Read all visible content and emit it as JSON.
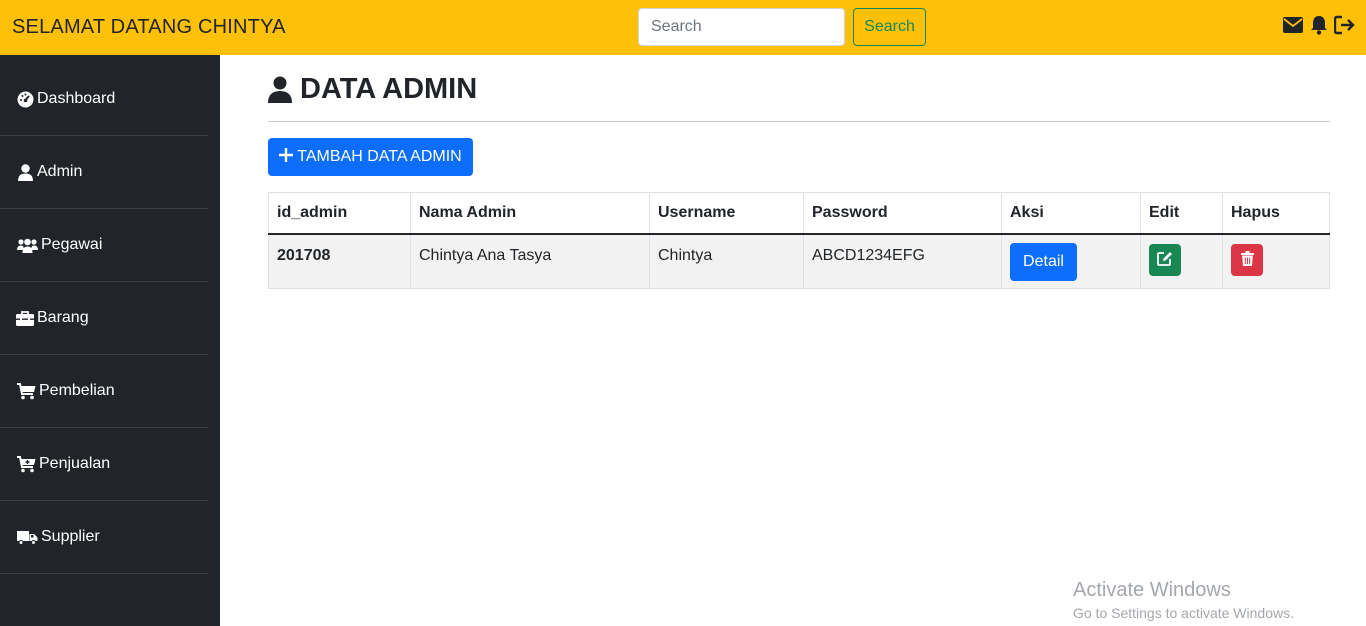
{
  "header": {
    "brand": "SELAMAT DATANG CHINTYA",
    "search_placeholder": "Search",
    "search_button": "Search",
    "icons": [
      "envelope-icon",
      "bell-icon",
      "logout-icon"
    ]
  },
  "sidebar": {
    "items": [
      {
        "label": "Dashboard",
        "icon": "dashboard-icon"
      },
      {
        "label": "Admin",
        "icon": "user-icon"
      },
      {
        "label": "Pegawai",
        "icon": "users-icon"
      },
      {
        "label": "Barang",
        "icon": "toolbox-icon"
      },
      {
        "label": "Pembelian",
        "icon": "cart-icon"
      },
      {
        "label": "Penjualan",
        "icon": "cart-plus-icon"
      },
      {
        "label": "Supplier",
        "icon": "truck-icon"
      }
    ]
  },
  "main": {
    "title": "DATA ADMIN",
    "add_button": "TAMBAH DATA ADMIN",
    "table": {
      "columns": [
        "id_admin",
        "Nama Admin",
        "Username",
        "Password",
        "Aksi",
        "Edit",
        "Hapus"
      ],
      "rows": [
        {
          "id_admin": "201708",
          "nama": "Chintya Ana Tasya",
          "username": "Chintya",
          "password": "ABCD1234EFG",
          "aksi": "Detail"
        }
      ]
    }
  },
  "watermark": {
    "line1": "Activate Windows",
    "line2": "Go to Settings to activate Windows."
  },
  "colors": {
    "topbar": "#ffc107",
    "sidebar": "#212529",
    "primary": "#0d6efd",
    "success": "#198754",
    "danger": "#dc3545"
  }
}
